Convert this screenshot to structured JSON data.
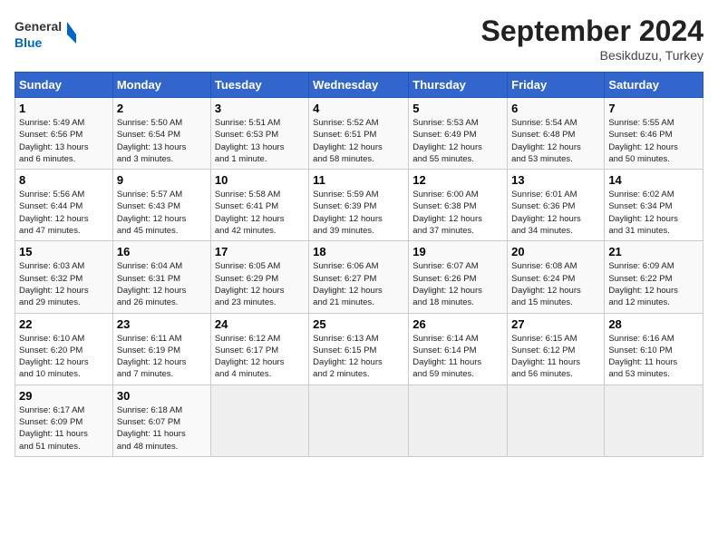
{
  "header": {
    "logo_text_general": "General",
    "logo_text_blue": "Blue",
    "month_year": "September 2024",
    "location": "Besikduzu, Turkey"
  },
  "days_of_week": [
    "Sunday",
    "Monday",
    "Tuesday",
    "Wednesday",
    "Thursday",
    "Friday",
    "Saturday"
  ],
  "weeks": [
    [
      {
        "num": "1",
        "info": "Sunrise: 5:49 AM\nSunset: 6:56 PM\nDaylight: 13 hours\nand 6 minutes."
      },
      {
        "num": "2",
        "info": "Sunrise: 5:50 AM\nSunset: 6:54 PM\nDaylight: 13 hours\nand 3 minutes."
      },
      {
        "num": "3",
        "info": "Sunrise: 5:51 AM\nSunset: 6:53 PM\nDaylight: 13 hours\nand 1 minute."
      },
      {
        "num": "4",
        "info": "Sunrise: 5:52 AM\nSunset: 6:51 PM\nDaylight: 12 hours\nand 58 minutes."
      },
      {
        "num": "5",
        "info": "Sunrise: 5:53 AM\nSunset: 6:49 PM\nDaylight: 12 hours\nand 55 minutes."
      },
      {
        "num": "6",
        "info": "Sunrise: 5:54 AM\nSunset: 6:48 PM\nDaylight: 12 hours\nand 53 minutes."
      },
      {
        "num": "7",
        "info": "Sunrise: 5:55 AM\nSunset: 6:46 PM\nDaylight: 12 hours\nand 50 minutes."
      }
    ],
    [
      {
        "num": "8",
        "info": "Sunrise: 5:56 AM\nSunset: 6:44 PM\nDaylight: 12 hours\nand 47 minutes."
      },
      {
        "num": "9",
        "info": "Sunrise: 5:57 AM\nSunset: 6:43 PM\nDaylight: 12 hours\nand 45 minutes."
      },
      {
        "num": "10",
        "info": "Sunrise: 5:58 AM\nSunset: 6:41 PM\nDaylight: 12 hours\nand 42 minutes."
      },
      {
        "num": "11",
        "info": "Sunrise: 5:59 AM\nSunset: 6:39 PM\nDaylight: 12 hours\nand 39 minutes."
      },
      {
        "num": "12",
        "info": "Sunrise: 6:00 AM\nSunset: 6:38 PM\nDaylight: 12 hours\nand 37 minutes."
      },
      {
        "num": "13",
        "info": "Sunrise: 6:01 AM\nSunset: 6:36 PM\nDaylight: 12 hours\nand 34 minutes."
      },
      {
        "num": "14",
        "info": "Sunrise: 6:02 AM\nSunset: 6:34 PM\nDaylight: 12 hours\nand 31 minutes."
      }
    ],
    [
      {
        "num": "15",
        "info": "Sunrise: 6:03 AM\nSunset: 6:32 PM\nDaylight: 12 hours\nand 29 minutes."
      },
      {
        "num": "16",
        "info": "Sunrise: 6:04 AM\nSunset: 6:31 PM\nDaylight: 12 hours\nand 26 minutes."
      },
      {
        "num": "17",
        "info": "Sunrise: 6:05 AM\nSunset: 6:29 PM\nDaylight: 12 hours\nand 23 minutes."
      },
      {
        "num": "18",
        "info": "Sunrise: 6:06 AM\nSunset: 6:27 PM\nDaylight: 12 hours\nand 21 minutes."
      },
      {
        "num": "19",
        "info": "Sunrise: 6:07 AM\nSunset: 6:26 PM\nDaylight: 12 hours\nand 18 minutes."
      },
      {
        "num": "20",
        "info": "Sunrise: 6:08 AM\nSunset: 6:24 PM\nDaylight: 12 hours\nand 15 minutes."
      },
      {
        "num": "21",
        "info": "Sunrise: 6:09 AM\nSunset: 6:22 PM\nDaylight: 12 hours\nand 12 minutes."
      }
    ],
    [
      {
        "num": "22",
        "info": "Sunrise: 6:10 AM\nSunset: 6:20 PM\nDaylight: 12 hours\nand 10 minutes."
      },
      {
        "num": "23",
        "info": "Sunrise: 6:11 AM\nSunset: 6:19 PM\nDaylight: 12 hours\nand 7 minutes."
      },
      {
        "num": "24",
        "info": "Sunrise: 6:12 AM\nSunset: 6:17 PM\nDaylight: 12 hours\nand 4 minutes."
      },
      {
        "num": "25",
        "info": "Sunrise: 6:13 AM\nSunset: 6:15 PM\nDaylight: 12 hours\nand 2 minutes."
      },
      {
        "num": "26",
        "info": "Sunrise: 6:14 AM\nSunset: 6:14 PM\nDaylight: 11 hours\nand 59 minutes."
      },
      {
        "num": "27",
        "info": "Sunrise: 6:15 AM\nSunset: 6:12 PM\nDaylight: 11 hours\nand 56 minutes."
      },
      {
        "num": "28",
        "info": "Sunrise: 6:16 AM\nSunset: 6:10 PM\nDaylight: 11 hours\nand 53 minutes."
      }
    ],
    [
      {
        "num": "29",
        "info": "Sunrise: 6:17 AM\nSunset: 6:09 PM\nDaylight: 11 hours\nand 51 minutes."
      },
      {
        "num": "30",
        "info": "Sunrise: 6:18 AM\nSunset: 6:07 PM\nDaylight: 11 hours\nand 48 minutes."
      },
      {
        "num": "",
        "info": ""
      },
      {
        "num": "",
        "info": ""
      },
      {
        "num": "",
        "info": ""
      },
      {
        "num": "",
        "info": ""
      },
      {
        "num": "",
        "info": ""
      }
    ]
  ]
}
